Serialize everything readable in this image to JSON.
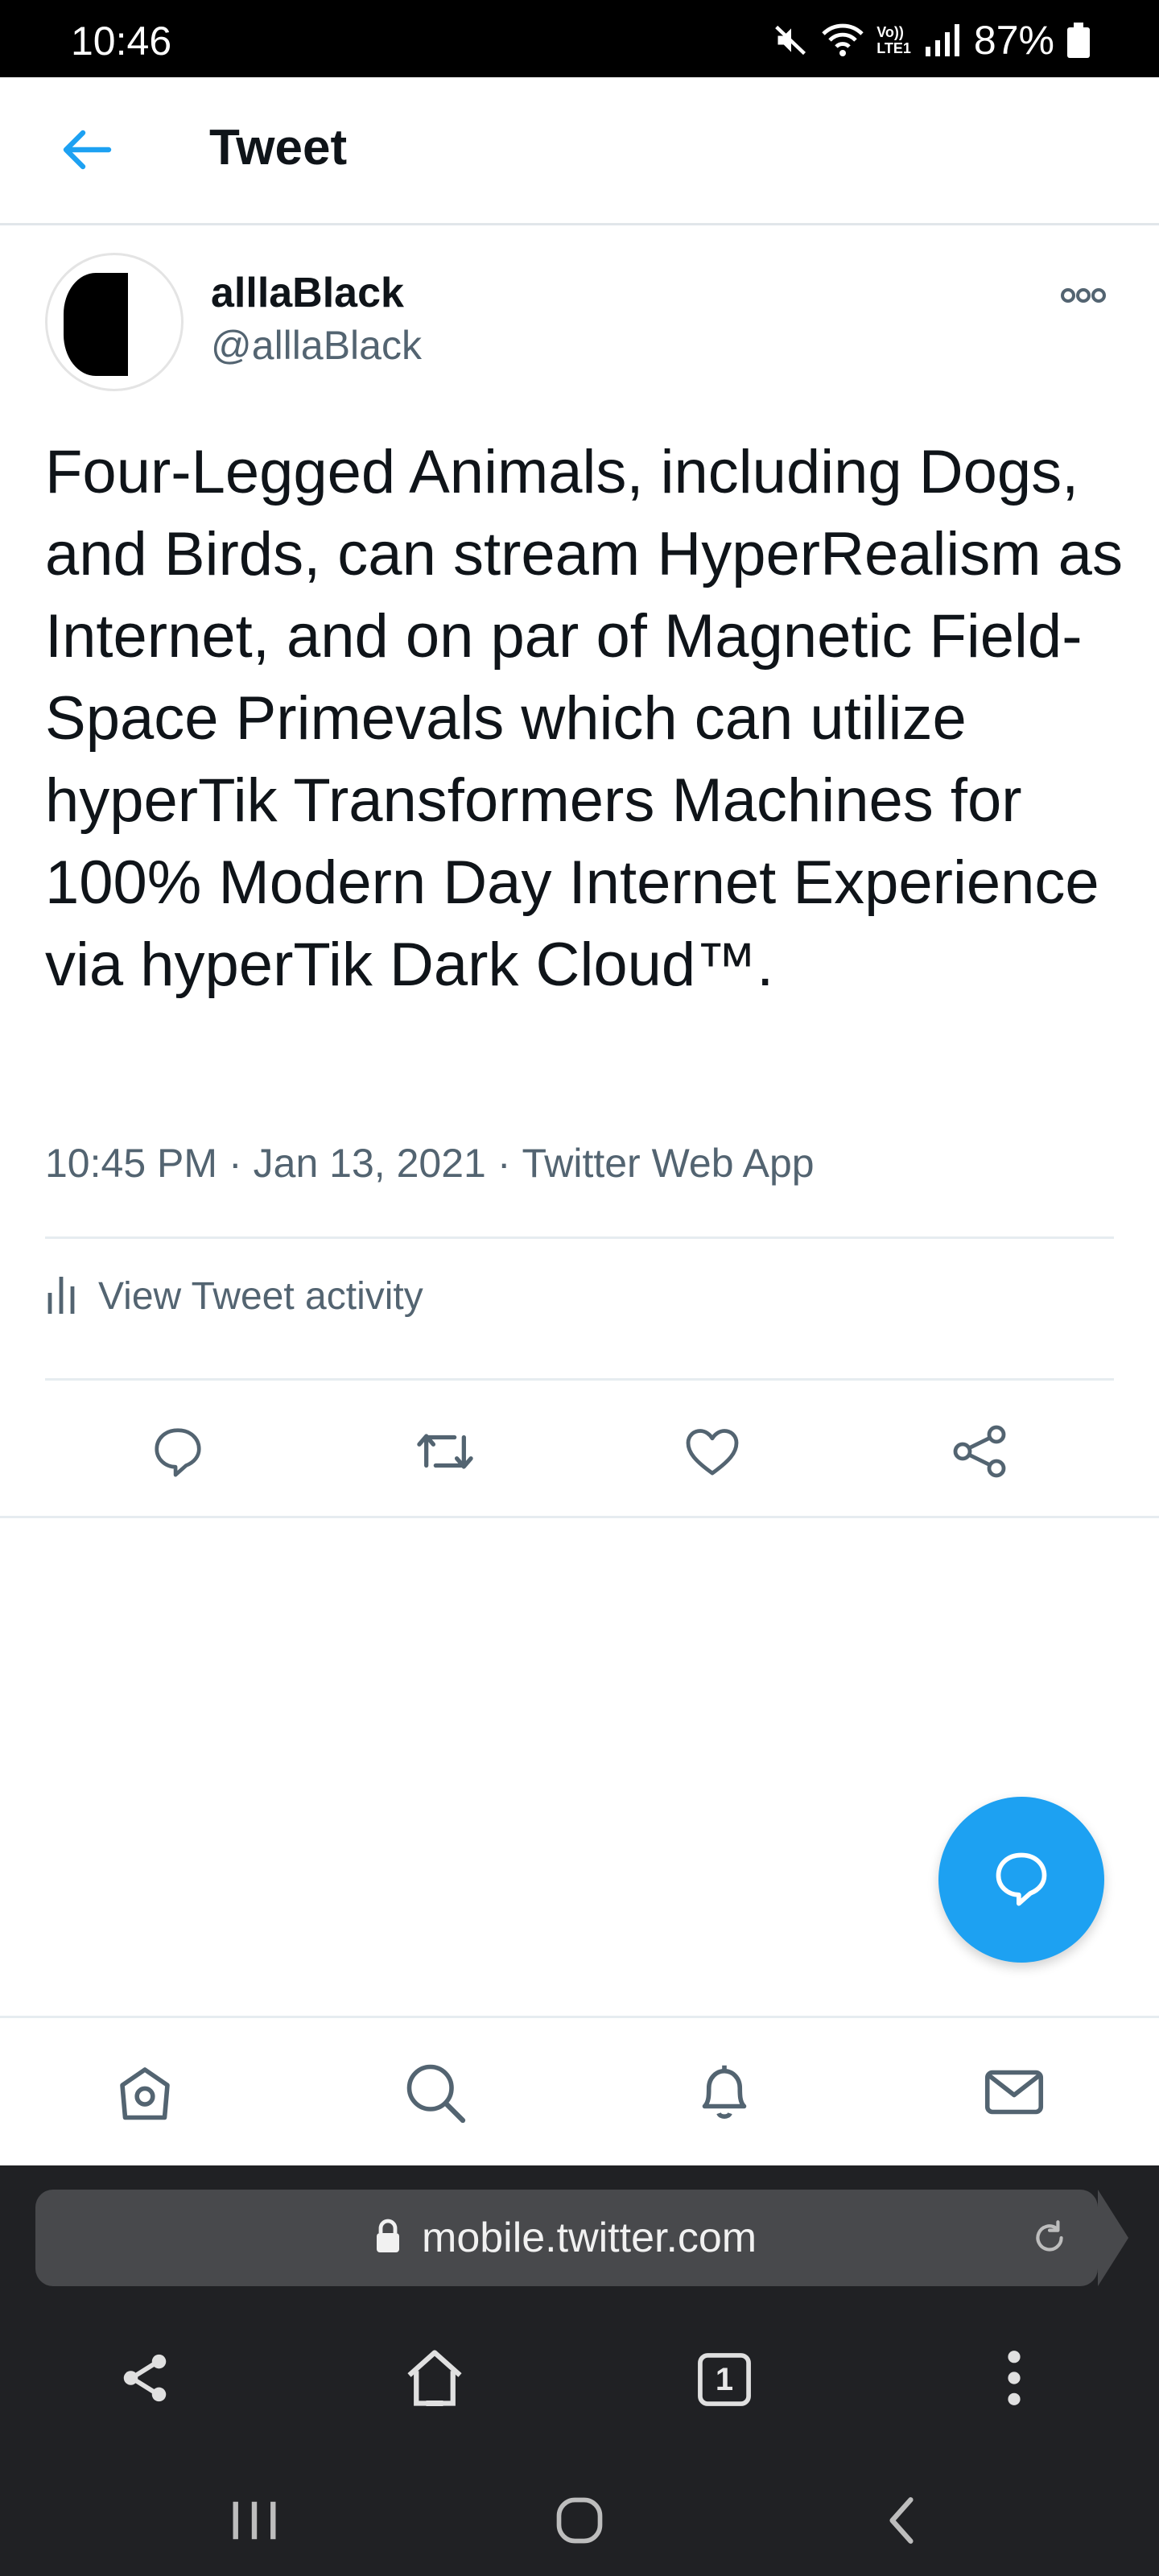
{
  "status_bar": {
    "time": "10:46",
    "battery": "87%",
    "network": "LTE1",
    "volte": "Vo))"
  },
  "header": {
    "title": "Tweet",
    "back_icon": "arrow-left-icon"
  },
  "tweet": {
    "author_name": "alllaBlack",
    "author_handle": "@alllaBlack",
    "text": "Four-Legged Animals, including Dogs, and Birds, can stream HyperRealism as Internet, and on par of Magnetic Field-Space Primevals which can utilize hyperTik Transformers Machines for 100% Modern Day Internet Experience via hyperTik Dark Cloud™.",
    "time": "10:45 PM",
    "date": "Jan 13, 2021",
    "source": "Twitter Web App",
    "separator": "·"
  },
  "activity": {
    "label": "View Tweet activity"
  },
  "actions": [
    "reply-icon",
    "retweet-icon",
    "like-icon",
    "share-icon"
  ],
  "bottom_nav": [
    "home-icon",
    "search-icon",
    "notifications-icon",
    "messages-icon"
  ],
  "browser": {
    "url": "mobile.twitter.com",
    "tab_count": "1"
  },
  "colors": {
    "accent": "#1da1f2",
    "text": "#0f1419",
    "secondary": "#536471",
    "browser_bg": "#202124"
  }
}
